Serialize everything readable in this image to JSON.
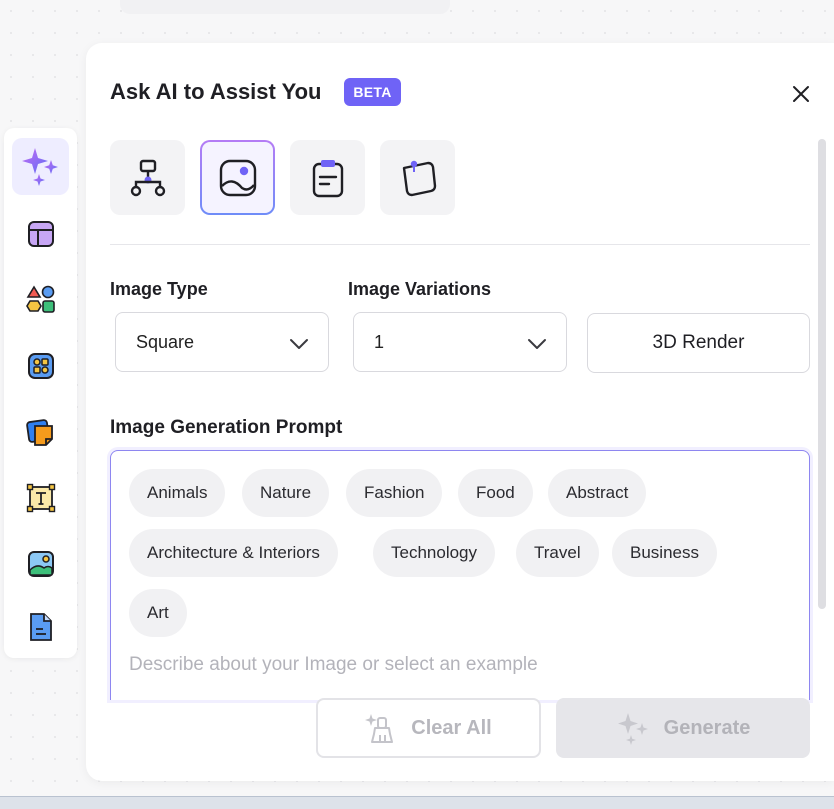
{
  "panel": {
    "title": "Ask AI to Assist You",
    "badge": "BETA"
  },
  "mode_tabs": [
    {
      "name": "flowchart",
      "icon": "flowchart-icon",
      "active": false
    },
    {
      "name": "image",
      "icon": "image-icon",
      "active": true
    },
    {
      "name": "document",
      "icon": "clipboard-icon",
      "active": false
    },
    {
      "name": "sticky-note",
      "icon": "sticky-note-icon",
      "active": false
    }
  ],
  "fields": {
    "image_type": {
      "label": "Image Type",
      "value": "Square"
    },
    "image_variations": {
      "label": "Image Variations",
      "value": "1"
    },
    "style": {
      "value": "3D Render"
    }
  },
  "prompt": {
    "label": "Image Generation Prompt",
    "placeholder": "Describe about your Image or select an example",
    "chips": [
      "Animals",
      "Nature",
      "Fashion",
      "Food",
      "Abstract",
      "Architecture & Interiors",
      "Technology",
      "Travel",
      "Business",
      "Art"
    ]
  },
  "actions": {
    "clear_all": "Clear All",
    "generate": "Generate"
  },
  "left_toolbar": [
    "ai-sparkle-icon",
    "layout-icon",
    "shapes-icon",
    "components-icon",
    "sticky-notes-icon",
    "text-box-icon",
    "image-icon",
    "document-icon"
  ],
  "colors": {
    "accent": "#6f63f6",
    "prompt_border": "#8e86f0"
  }
}
